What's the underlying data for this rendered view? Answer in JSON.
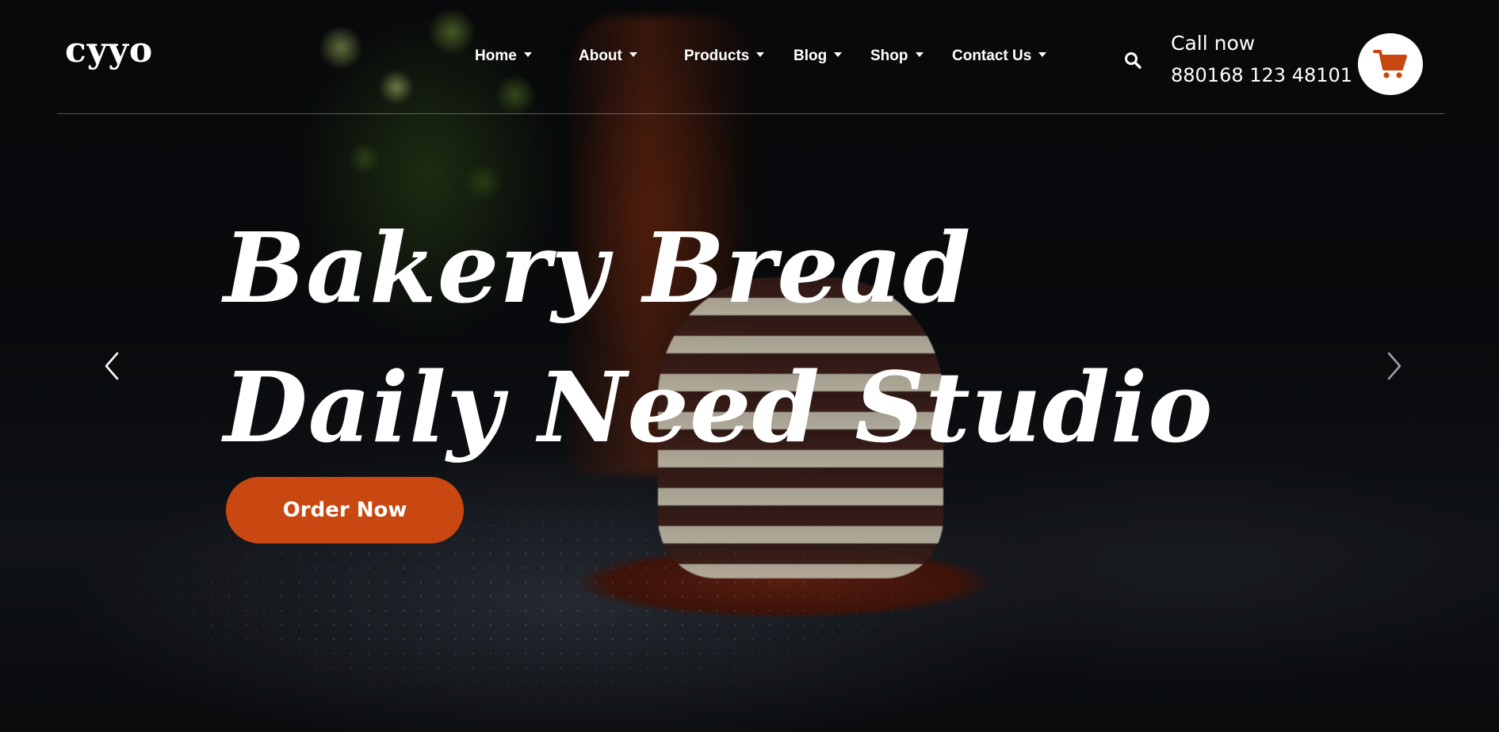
{
  "brand": {
    "logo_text": "cyyo"
  },
  "nav": {
    "items": [
      {
        "label": "Home"
      },
      {
        "label": "About"
      },
      {
        "label": "Products"
      },
      {
        "label": "Blog"
      },
      {
        "label": "Shop"
      },
      {
        "label": "Contact Us"
      }
    ]
  },
  "header": {
    "search_icon": "search-icon",
    "call_label": "Call now",
    "call_number": "880168 123 48101",
    "cart_icon": "shopping-cart-icon"
  },
  "hero": {
    "headline_line1": "Bakery Bread",
    "headline_line2": "Daily Need Studio",
    "cta_label": "Order Now",
    "prev_icon": "chevron-left-icon",
    "next_icon": "chevron-right-icon"
  },
  "colors": {
    "accent": "#c94710",
    "text": "#ffffff",
    "background": "#07090b"
  }
}
